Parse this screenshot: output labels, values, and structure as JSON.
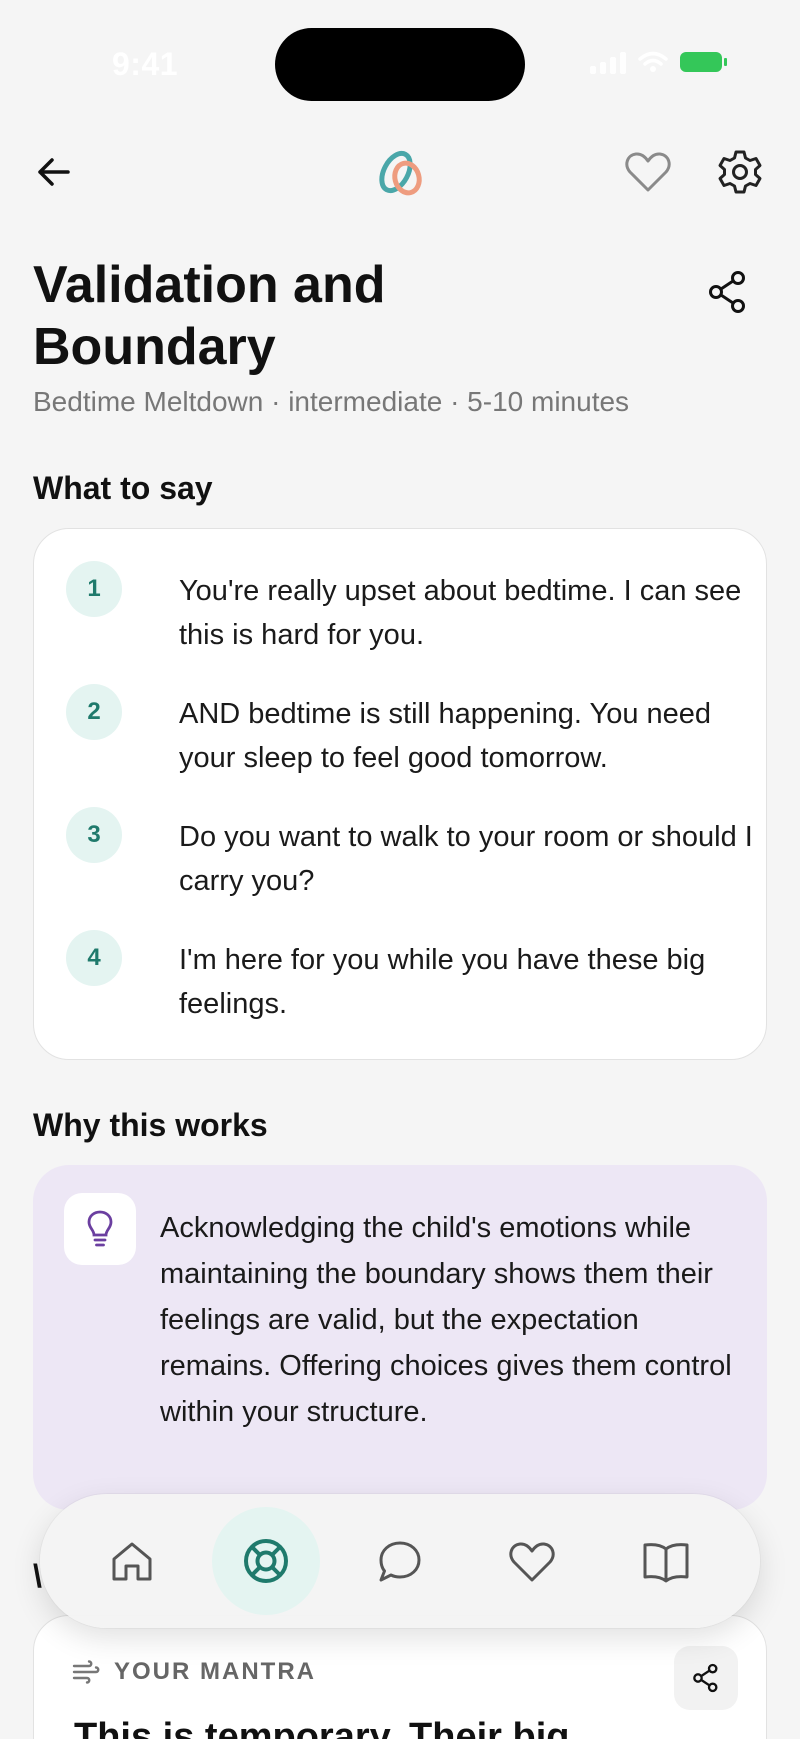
{
  "status": {
    "time": "9:41"
  },
  "header": {
    "icons": [
      "arrow-left-icon",
      "app-logo",
      "heart-icon",
      "gear-icon"
    ]
  },
  "technique": {
    "title": "Validation and Boundary",
    "meta": "Bedtime Meltdown · intermediate · 5-10 minutes"
  },
  "what_to_say": {
    "heading": "What to say",
    "steps": [
      {
        "num": "1",
        "text": "You're really upset about bedtime. I can see this is hard for you."
      },
      {
        "num": "2",
        "text": "AND bedtime is still happening. You need your sleep to feel good tomorrow."
      },
      {
        "num": "3",
        "text": "Do you want to walk to your room or should I carry you?"
      },
      {
        "num": "4",
        "text": "I'm here for you while you have these big feelings."
      }
    ]
  },
  "why": {
    "heading": "Why this works",
    "text": "Acknowledging the child's emotions while maintaining the boundary shows them their feelings are valid, but the expectation remains. Offering choices gives them control within your structure."
  },
  "mantra": {
    "label": "YOUR MANTRA",
    "text": "This is temporary. Their big"
  },
  "tabbar": {
    "tabs": [
      "home-icon",
      "lifebuoy-icon",
      "chat-icon",
      "heart-icon",
      "book-icon"
    ],
    "active": 1
  },
  "colors": {
    "accent": "#1f7a6c",
    "accent_soft": "#e4f4f1",
    "why_bg": "#ede7f5",
    "bulb": "#6b3fa0"
  }
}
